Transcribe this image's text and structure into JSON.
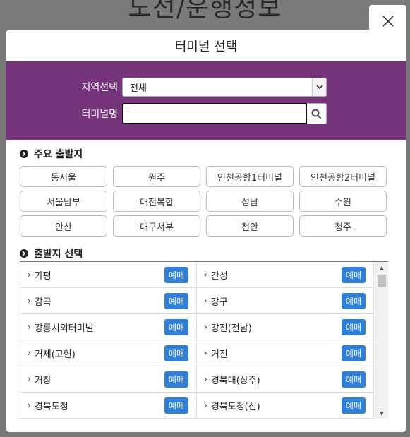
{
  "background": {
    "title": "노선/운행정보"
  },
  "modal": {
    "title": "터미널 선택",
    "close_icon": "close-icon",
    "accent": "#76357a",
    "search": {
      "region_label": "지역선택",
      "region_value": "전체",
      "terminal_label": "터미널명",
      "terminal_value": ""
    },
    "main_section": {
      "title": "주요 출발지",
      "items": [
        "동서울",
        "원주",
        "인천공항1터미널",
        "인천공항2터미널",
        "서울남부",
        "대전복합",
        "성남",
        "수원",
        "안산",
        "대구서부",
        "천안",
        "청주"
      ]
    },
    "departure_section": {
      "title": "출발지 선택",
      "book_label": "예매",
      "book_color": "#2f7fd6",
      "rows": [
        [
          "가평",
          "간성"
        ],
        [
          "감곡",
          "강구"
        ],
        [
          "강릉시외터미널",
          "강진(전남)"
        ],
        [
          "거제(고현)",
          "거진"
        ],
        [
          "거창",
          "경북대(상주)"
        ],
        [
          "경북도청",
          "경북도청(신)"
        ]
      ]
    }
  }
}
